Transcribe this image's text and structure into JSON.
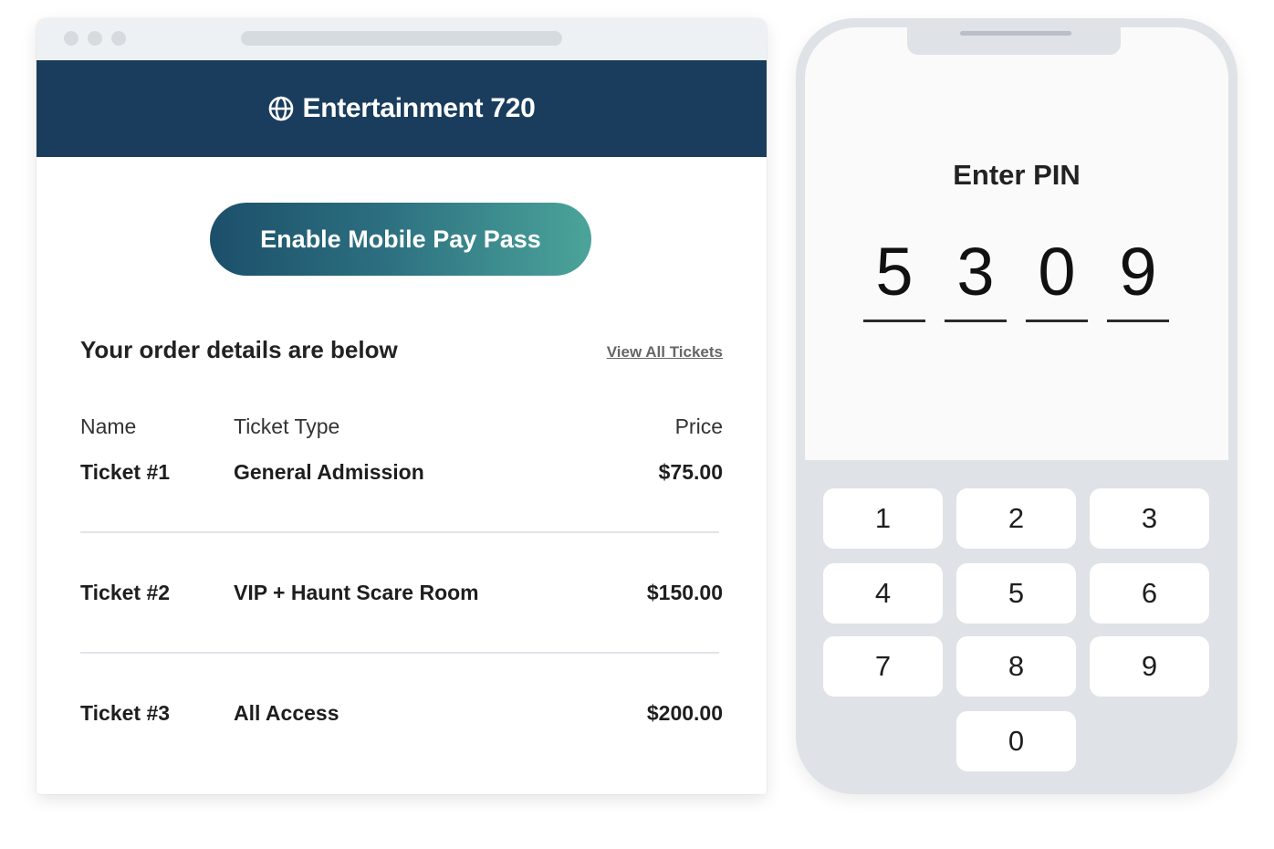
{
  "email": {
    "brand_title": "Entertainment 720",
    "cta_label": "Enable Mobile Pay Pass",
    "order_heading": "Your order details are below",
    "view_all_link": "View All Tickets",
    "columns": {
      "name": "Name",
      "type": "Ticket Type",
      "price": "Price"
    },
    "tickets": [
      {
        "name": "Ticket #1",
        "type": "General Admission",
        "price": "$75.00"
      },
      {
        "name": "Ticket #2",
        "type": "VIP + Haunt Scare Room",
        "price": "$150.00"
      },
      {
        "name": "Ticket #3",
        "type": "All Access",
        "price": "$200.00"
      }
    ],
    "colors": {
      "banner": "#1a3d5e",
      "cta_start": "#1c4f6a",
      "cta_end": "#4ba49a"
    },
    "icons": {
      "brand": "globe-icon"
    }
  },
  "phone": {
    "pin_title": "Enter PIN",
    "pin_digits": [
      "5",
      "3",
      "0",
      "9"
    ],
    "keypad": [
      "1",
      "2",
      "3",
      "4",
      "5",
      "6",
      "7",
      "8",
      "9",
      "0"
    ]
  }
}
